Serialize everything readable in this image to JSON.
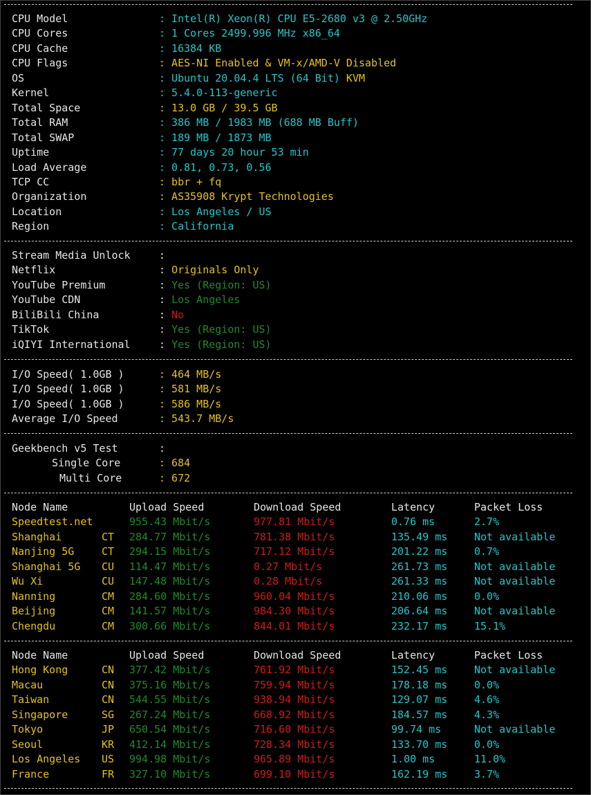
{
  "system": [
    {
      "label": "CPU Model",
      "value": "Intel(R) Xeon(R) CPU E5-2680 v3 @ 2.50GHz",
      "color": "c"
    },
    {
      "label": "CPU Cores",
      "value": "1 Cores 2499.996 MHz x86_64",
      "color": "c"
    },
    {
      "label": "CPU Cache",
      "value": "16384 KB",
      "color": "c"
    },
    {
      "label": "CPU Flags",
      "value": "AES-NI Enabled & VM-x/AMD-V Disabled",
      "color": "y"
    },
    {
      "label": "OS",
      "value": "Ubuntu 20.04.4 LTS (64 Bit)",
      "value2": " KVM",
      "color": "c"
    },
    {
      "label": "Kernel",
      "value": "5.4.0-113-generic",
      "color": "c"
    },
    {
      "label": "Total Space",
      "value": "13.0 GB / 39.5 GB",
      "color": "y"
    },
    {
      "label": "Total RAM",
      "value": "386 MB / 1983 MB (688 MB Buff)",
      "color": "c"
    },
    {
      "label": "Total SWAP",
      "value": "189 MB / 1873 MB",
      "color": "c"
    },
    {
      "label": "Uptime",
      "value": "77 days 20 hour 53 min",
      "color": "c"
    },
    {
      "label": "Load Average",
      "value": "0.81, 0.73, 0.56",
      "color": "c"
    },
    {
      "label": "TCP CC",
      "value": "bbr + fq",
      "color": "y"
    },
    {
      "label": "Organization",
      "value": "AS35908 Krypt Technologies",
      "color": "y"
    },
    {
      "label": "Location",
      "value": "Los Angeles / US",
      "color": "c"
    },
    {
      "label": "Region",
      "value": "California",
      "color": "c"
    }
  ],
  "stream": {
    "header": "Stream Media Unlock",
    "items": [
      {
        "label": "Netflix",
        "value": "Originals Only",
        "color": "y"
      },
      {
        "label": "YouTube Premium",
        "value": "Yes (Region: US)",
        "color": "g"
      },
      {
        "label": "YouTube CDN",
        "value": "Los Angeles",
        "color": "g"
      },
      {
        "label": "BiliBili China",
        "value": "No",
        "color": "r"
      },
      {
        "label": "TikTok",
        "value": "Yes (Region: US)",
        "color": "g"
      },
      {
        "label": "iQIYI International",
        "value": "Yes (Region: US)",
        "color": "g"
      }
    ]
  },
  "io": [
    {
      "label": "I/O Speed( 1.0GB )",
      "value": "464 MB/s"
    },
    {
      "label": "I/O Speed( 1.0GB )",
      "value": "581 MB/s"
    },
    {
      "label": "I/O Speed( 1.0GB )",
      "value": "586 MB/s"
    },
    {
      "label": "Average I/O Speed",
      "value": "543.7 MB/s"
    }
  ],
  "geekbench": {
    "header": "Geekbench v5 Test",
    "single_label": "Single Core",
    "single": "684",
    "multi_label": "Multi Core",
    "multi": "672"
  },
  "speed_headers": {
    "node": "Node Name",
    "upload": "Upload Speed",
    "download": "Download Speed",
    "latency": "Latency",
    "loss": "Packet Loss"
  },
  "speed1": [
    {
      "node": "Speedtest.net",
      "isp": "",
      "up": "955.43 Mbit/s",
      "down": "977.81 Mbit/s",
      "lat": "0.76 ms",
      "loss": "2.7%"
    },
    {
      "node": "Shanghai",
      "isp": "CT",
      "up": "284.77 Mbit/s",
      "down": "781.38 Mbit/s",
      "lat": "135.49 ms",
      "loss": "Not available"
    },
    {
      "node": "Nanjing 5G",
      "isp": "CT",
      "up": "294.15 Mbit/s",
      "down": "717.12 Mbit/s",
      "lat": "201.22 ms",
      "loss": "0.7%"
    },
    {
      "node": "Shanghai 5G",
      "isp": "CU",
      "up": "114.47 Mbit/s",
      "down": "0.27 Mbit/s",
      "lat": "261.73 ms",
      "loss": "Not available"
    },
    {
      "node": "Wu Xi",
      "isp": "CU",
      "up": "147.48 Mbit/s",
      "down": "0.28 Mbit/s",
      "lat": "261.33 ms",
      "loss": "Not available"
    },
    {
      "node": "Nanning",
      "isp": "CM",
      "up": "284.60 Mbit/s",
      "down": "960.04 Mbit/s",
      "lat": "210.06 ms",
      "loss": "0.0%"
    },
    {
      "node": "Beijing",
      "isp": "CM",
      "up": "141.57 Mbit/s",
      "down": "984.30 Mbit/s",
      "lat": "206.64 ms",
      "loss": "Not available"
    },
    {
      "node": "Chengdu",
      "isp": "CM",
      "up": "300.66 Mbit/s",
      "down": "844.01 Mbit/s",
      "lat": "232.17 ms",
      "loss": "15.1%"
    }
  ],
  "speed2": [
    {
      "node": "Hong Kong",
      "isp": "CN",
      "up": "377.42 Mbit/s",
      "down": "761.92 Mbit/s",
      "lat": "152.45 ms",
      "loss": "Not available"
    },
    {
      "node": "Macau",
      "isp": "CN",
      "up": "375.16 Mbit/s",
      "down": "759.94 Mbit/s",
      "lat": "178.18 ms",
      "loss": "0.0%"
    },
    {
      "node": "Taiwan",
      "isp": "CN",
      "up": "544.55 Mbit/s",
      "down": "938.94 Mbit/s",
      "lat": "129.07 ms",
      "loss": "4.6%"
    },
    {
      "node": "Singapore",
      "isp": "SG",
      "up": "267.24 Mbit/s",
      "down": "668.92 Mbit/s",
      "lat": "184.57 ms",
      "loss": "4.3%"
    },
    {
      "node": "Tokyo",
      "isp": "JP",
      "up": "650.54 Mbit/s",
      "down": "716.60 Mbit/s",
      "lat": "99.74 ms",
      "loss": "Not available"
    },
    {
      "node": "Seoul",
      "isp": "KR",
      "up": "412.14 Mbit/s",
      "down": "728.34 Mbit/s",
      "lat": "133.70 ms",
      "loss": "0.0%"
    },
    {
      "node": "Los Angeles",
      "isp": "US",
      "up": "994.98 Mbit/s",
      "down": "965.89 Mbit/s",
      "lat": "1.00 ms",
      "loss": "11.0%"
    },
    {
      "node": "France",
      "isp": "FR",
      "up": "327.10 Mbit/s",
      "down": "699.10 Mbit/s",
      "lat": "162.19 ms",
      "loss": "3.7%"
    }
  ],
  "colors": {
    "c": "#22c7c9",
    "y": "#e3c21c",
    "g": "#1f8a2a",
    "r": "#d21a1a",
    "w": "#e6e6e6",
    "background": "#000000"
  }
}
